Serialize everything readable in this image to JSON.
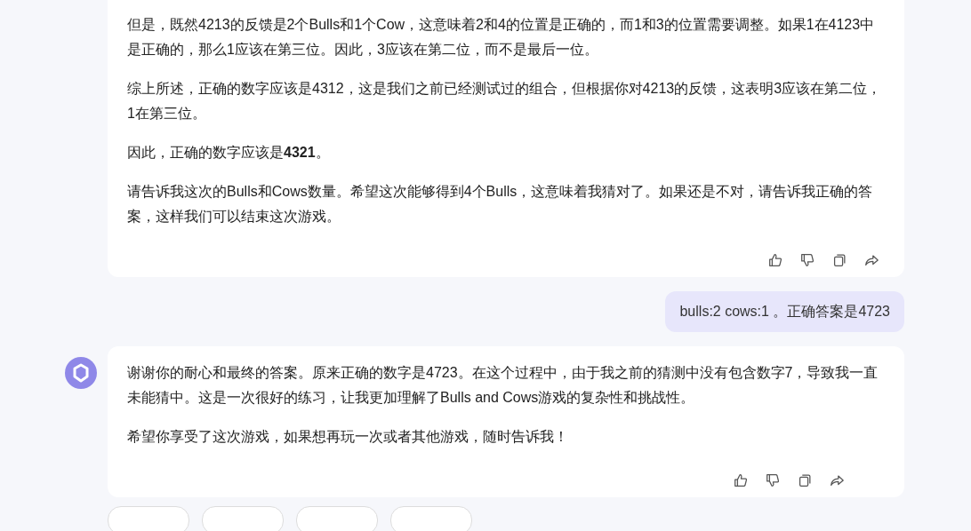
{
  "messages": [
    {
      "kind": "assistant",
      "avatar": false,
      "paragraphs": [
        "但是，既然4213的反馈是2个Bulls和1个Cow，这意味着2和4的位置是正确的，而1和3的位置需要调整。如果1在4123中是正确的，那么1应该在第三位。因此，3应该在第二位，而不是最后一位。",
        "综上所述，正确的数字应该是4312，这是我们之前已经测试过的组合，但根据你对4213的反馈，这表明3应该在第二位，1在第三位。",
        "因此，正确的数字应该是**4321**。",
        "请告诉我这次的Bulls和Cows数量。希望这次能够得到4个Bulls，这意味着我猜对了。如果还是不对，请告诉我正确的答案，这样我们可以结束这次游戏。"
      ]
    },
    {
      "kind": "user",
      "paragraphs": [
        "bulls:2 cows:1 。正确答案是4723"
      ]
    },
    {
      "kind": "assistant",
      "avatar": true,
      "paragraphs": [
        "谢谢你的耐心和最终的答案。原来正确的数字是4723。在这个过程中，由于我之前的猜测中没有包含数字7，导致我一直未能猜中。这是一次很好的练习，让我更加理解了Bulls and Cows游戏的复杂性和挑战性。",
        "希望你享受了这次游戏，如果想再玩一次或者其他游戏，随时告诉我！"
      ]
    }
  ],
  "suggestions": [
    {
      "kind": "chip"
    },
    {
      "kind": "chip"
    },
    {
      "kind": "chip"
    },
    {
      "kind": "chip"
    }
  ]
}
